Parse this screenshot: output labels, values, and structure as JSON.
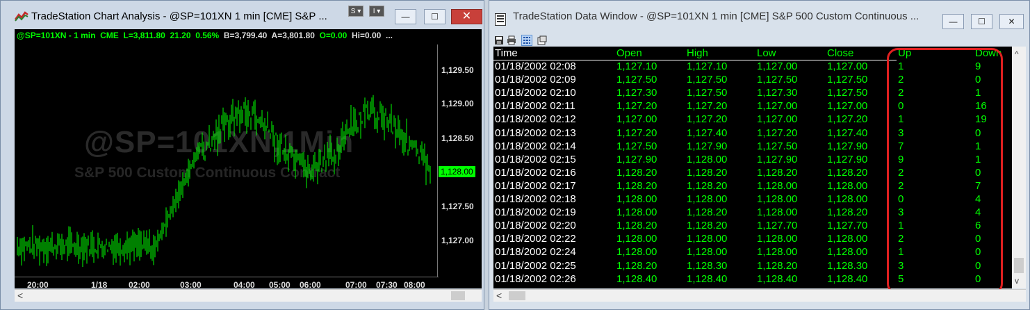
{
  "chart_window": {
    "title": "TradeStation Chart Analysis - @SP=101XN 1 min [CME] S&P ...",
    "btn_s": "S ▾",
    "btn_i": "I ▾",
    "status": {
      "symbol": "@SP=101XN - 1 min",
      "exchange": "CME",
      "last": "L=3,811.80",
      "change": "21.20",
      "pct": "0.56%",
      "bid": "B=3,799.40",
      "ask": "A=3,801.80",
      "open": "O=0.00",
      "high": "Hi=0.00",
      "more": "..."
    },
    "watermark_symbol": "@SP=101XN,1Min",
    "watermark_desc": "S&P 500 Custom Continuous Contract",
    "y_ticks": [
      "1,129.50",
      "1,129.00",
      "1,128.50",
      "1,127.50",
      "1,127.00"
    ],
    "current_price": "1,128.00",
    "x_ticks": [
      "20:00",
      "1/18",
      "02:00",
      "03:00",
      "04:00",
      "05:00",
      "06:00",
      "07:00",
      "07:30",
      "08:00"
    ]
  },
  "data_window": {
    "title": "TradeStation Data Window - @SP=101XN 1 min [CME] S&P 500 Custom Continuous ...",
    "columns": [
      "Time",
      "Open",
      "High",
      "Low",
      "Close",
      "Up",
      "Down"
    ],
    "rows": [
      [
        "01/18/2002 02:08",
        "1,127.10",
        "1,127.10",
        "1,127.00",
        "1,127.00",
        "1",
        "9"
      ],
      [
        "01/18/2002 02:09",
        "1,127.50",
        "1,127.50",
        "1,127.50",
        "1,127.50",
        "2",
        "0"
      ],
      [
        "01/18/2002 02:10",
        "1,127.30",
        "1,127.50",
        "1,127.30",
        "1,127.50",
        "2",
        "1"
      ],
      [
        "01/18/2002 02:11",
        "1,127.20",
        "1,127.20",
        "1,127.00",
        "1,127.00",
        "0",
        "16"
      ],
      [
        "01/18/2002 02:12",
        "1,127.00",
        "1,127.20",
        "1,127.00",
        "1,127.20",
        "1",
        "19"
      ],
      [
        "01/18/2002 02:13",
        "1,127.20",
        "1,127.40",
        "1,127.20",
        "1,127.40",
        "3",
        "0"
      ],
      [
        "01/18/2002 02:14",
        "1,127.50",
        "1,127.90",
        "1,127.50",
        "1,127.90",
        "7",
        "1"
      ],
      [
        "01/18/2002 02:15",
        "1,127.90",
        "1,128.00",
        "1,127.90",
        "1,127.90",
        "9",
        "1"
      ],
      [
        "01/18/2002 02:16",
        "1,128.20",
        "1,128.20",
        "1,128.20",
        "1,128.20",
        "2",
        "0"
      ],
      [
        "01/18/2002 02:17",
        "1,128.20",
        "1,128.20",
        "1,128.00",
        "1,128.00",
        "2",
        "7"
      ],
      [
        "01/18/2002 02:18",
        "1,128.00",
        "1,128.00",
        "1,128.00",
        "1,128.00",
        "0",
        "4"
      ],
      [
        "01/18/2002 02:19",
        "1,128.00",
        "1,128.20",
        "1,128.00",
        "1,128.20",
        "3",
        "4"
      ],
      [
        "01/18/2002 02:20",
        "1,128.20",
        "1,128.20",
        "1,127.70",
        "1,127.70",
        "1",
        "6"
      ],
      [
        "01/18/2002 02:22",
        "1,128.00",
        "1,128.00",
        "1,128.00",
        "1,128.00",
        "2",
        "0"
      ],
      [
        "01/18/2002 02:24",
        "1,128.00",
        "1,128.00",
        "1,128.00",
        "1,128.00",
        "1",
        "0"
      ],
      [
        "01/18/2002 02:25",
        "1,128.20",
        "1,128.30",
        "1,128.20",
        "1,128.30",
        "3",
        "0"
      ],
      [
        "01/18/2002 02:26",
        "1,128.40",
        "1,128.40",
        "1,128.40",
        "1,128.40",
        "5",
        "0"
      ]
    ]
  },
  "controls": {
    "minimize": "—",
    "maximize": "☐",
    "close": "✕",
    "scroll_left": "<",
    "scroll_up": "^",
    "scroll_down": "v"
  },
  "colors": {
    "chart_bg": "#000000",
    "price_green": "#00ff00",
    "highlight_red": "#e02020"
  }
}
